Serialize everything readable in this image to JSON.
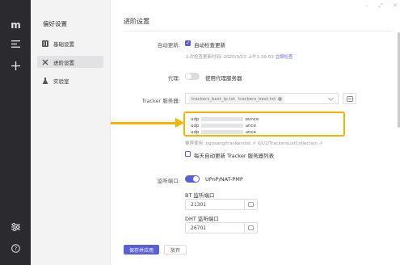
{
  "rail": {
    "logo": "m"
  },
  "subnav": {
    "title": "偏好设置",
    "items": [
      {
        "label": "基础设置",
        "icon": "sliders-icon"
      },
      {
        "label": "进阶设置",
        "icon": "tools-icon"
      },
      {
        "label": "实验室",
        "icon": "flask-icon"
      }
    ]
  },
  "window": {
    "min": "–",
    "max": "⤢",
    "close": "✕"
  },
  "page": {
    "title": "进阶设置"
  },
  "auto_update": {
    "label": "自动更新:",
    "checkbox_label": "自动检查更新",
    "last_check_prefix": "上次检查更新时间: 2020/9/23 上午1:39:03",
    "check_now": "立即检查"
  },
  "proxy": {
    "label": "代理:",
    "toggle_label": "使用代理服务器"
  },
  "tracker": {
    "label": "Tracker 服务器:",
    "tags": [
      "trackers_best_ip.txt",
      "trackers_best.txt"
    ],
    "lines": [
      {
        "prefix": "udp",
        "suffix": "ounce"
      },
      {
        "prefix": "udp",
        "suffix": "unce"
      },
      {
        "prefix": "udp",
        "suffix": "unce"
      }
    ],
    "recommend_prefix": "推荐使用:",
    "recommend_a": "ngosang/trackerslist",
    "recommend_b": "XIU2/TrackersListCollection",
    "daily_update": "每天自动更新 Tracker 服务器列表"
  },
  "listen": {
    "label": "监听端口:",
    "upnp": "UPnP/NAT-PMP",
    "bt_label": "BT 监听端口",
    "bt_value": "21301",
    "dht_label": "DHT 监听端口",
    "dht_value": "26701"
  },
  "actions": {
    "save": "保存并应用",
    "discard": "放弃"
  },
  "colors": {
    "accent": "#5b5fd6",
    "highlight": "#f4b400",
    "rail": "#2b2b2f"
  }
}
